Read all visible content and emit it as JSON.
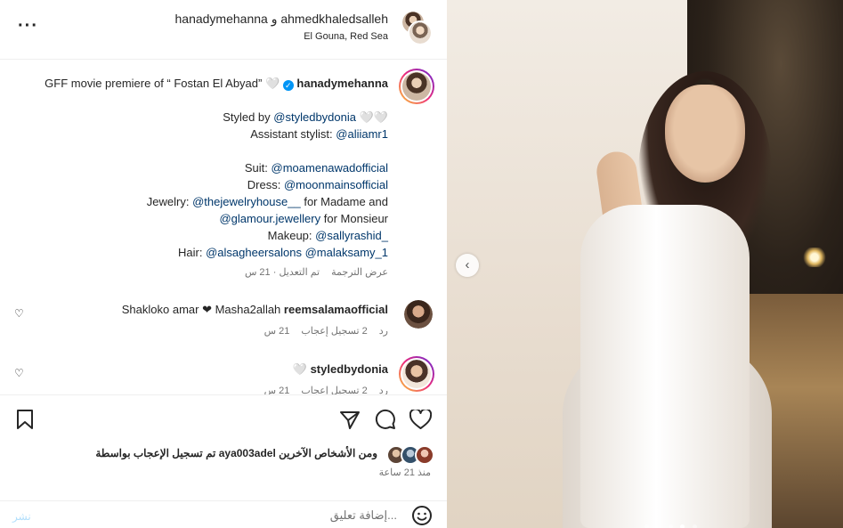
{
  "header": {
    "users": "hanadymehanna و ahmedkhaledsalleh",
    "location": "El Gouna, Red Sea"
  },
  "caption": {
    "title_text": "GFF movie premiere of “ Fostan El Abyad” 🤍",
    "username": "hanadymehanna",
    "verified_mark": "✓",
    "styled_by_label": "Styled by",
    "styled_by_tag": "@styledbydonia",
    "styled_by_emoji": "🤍🤍",
    "assistant_label": "Assistant stylist:",
    "assistant_tag": "@aliiamr1",
    "suit_label": "Suit:",
    "suit_tag": "@moamenawadofficial",
    "dress_label": "Dress:",
    "dress_tag": "@moonmainsofficial",
    "jewelry_label": "Jewelry:",
    "jewelry_tag": "@thejewelryhouse__",
    "jewelry_suffix": "for Madame and",
    "jewelry_tag2": "@glamour.jewellery",
    "jewelry_suffix2": "for Monsieur",
    "makeup_label": "Makeup:",
    "makeup_tag": "@sallyrashid_",
    "hair_label": "Hair:",
    "hair_tag1": "@alsagheersalons",
    "hair_tag2": "@malaksamy_1",
    "edited": "تم التعديل · 21 س",
    "translate": "عرض الترجمة"
  },
  "comments": [
    {
      "username": "reemsalamaofficial",
      "text": "Shakloko amar ❤ Masha2allah",
      "time": "21 س",
      "likes": "2 تسجيل إعجاب",
      "reply": "رد"
    },
    {
      "username": "styledbydonia",
      "text": "🤍",
      "time": "21 س",
      "likes": "2 تسجيل إعجاب",
      "reply": "رد"
    }
  ],
  "actions": {
    "likes_summary": "تم تسجيل الإعجاب بواسطة aya003adel ومن الأشخاص الآخرين",
    "time_ago": "منذ 21 ساعة",
    "comment_placeholder": "إضافة تعليق...",
    "post_label": "نشر"
  },
  "carousel": {
    "prev_glyph": "‹",
    "dot_count": 5,
    "active_dot": 4
  }
}
